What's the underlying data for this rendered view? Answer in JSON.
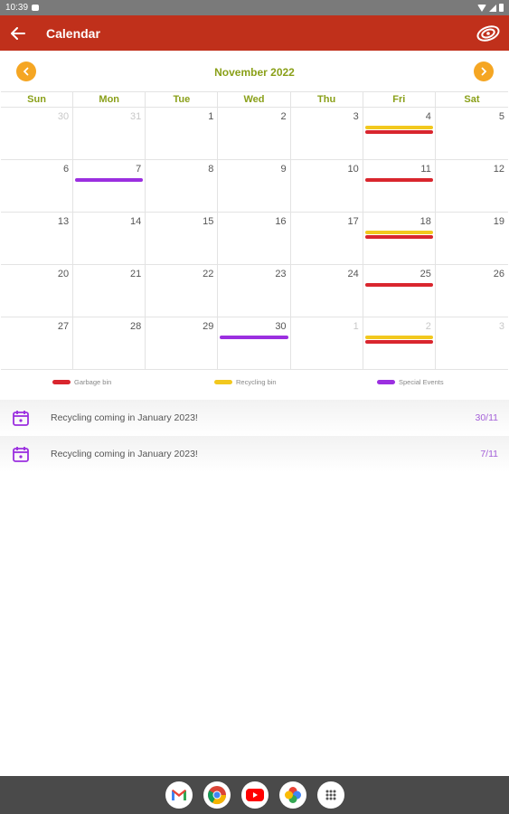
{
  "status_bar": {
    "time": "10:39"
  },
  "app_bar": {
    "title": "Calendar"
  },
  "calendar": {
    "month_title": "November 2022",
    "weekdays": [
      "Sun",
      "Mon",
      "Tue",
      "Wed",
      "Thu",
      "Fri",
      "Sat"
    ],
    "days": [
      {
        "d": "30",
        "other": true,
        "ev": []
      },
      {
        "d": "31",
        "other": true,
        "ev": []
      },
      {
        "d": "1",
        "ev": []
      },
      {
        "d": "2",
        "ev": []
      },
      {
        "d": "3",
        "ev": []
      },
      {
        "d": "4",
        "ev": [
          "recycling",
          "garbage"
        ]
      },
      {
        "d": "5",
        "ev": []
      },
      {
        "d": "6",
        "ev": []
      },
      {
        "d": "7",
        "ev": [
          "special"
        ]
      },
      {
        "d": "8",
        "ev": []
      },
      {
        "d": "9",
        "ev": []
      },
      {
        "d": "10",
        "ev": []
      },
      {
        "d": "11",
        "ev": [
          "garbage"
        ]
      },
      {
        "d": "12",
        "ev": []
      },
      {
        "d": "13",
        "ev": []
      },
      {
        "d": "14",
        "ev": []
      },
      {
        "d": "15",
        "ev": []
      },
      {
        "d": "16",
        "ev": []
      },
      {
        "d": "17",
        "ev": []
      },
      {
        "d": "18",
        "ev": [
          "recycling",
          "garbage"
        ]
      },
      {
        "d": "19",
        "ev": []
      },
      {
        "d": "20",
        "ev": []
      },
      {
        "d": "21",
        "ev": []
      },
      {
        "d": "22",
        "ev": []
      },
      {
        "d": "23",
        "ev": []
      },
      {
        "d": "24",
        "ev": []
      },
      {
        "d": "25",
        "ev": [
          "garbage"
        ]
      },
      {
        "d": "26",
        "ev": []
      },
      {
        "d": "27",
        "ev": []
      },
      {
        "d": "28",
        "ev": []
      },
      {
        "d": "29",
        "ev": []
      },
      {
        "d": "30",
        "ev": [
          "special"
        ]
      },
      {
        "d": "1",
        "other": true,
        "ev": []
      },
      {
        "d": "2",
        "other": true,
        "ev": [
          "recycling",
          "garbage"
        ]
      },
      {
        "d": "3",
        "other": true,
        "ev": []
      }
    ]
  },
  "colors": {
    "garbage": "#d9262e",
    "recycling": "#f2c81e",
    "special": "#9b2fe0",
    "accent": "#f5a623",
    "header": "#c0301b",
    "weekday_text": "#8aa019"
  },
  "legend": [
    {
      "key": "garbage",
      "label": "Garbage bin"
    },
    {
      "key": "recycling",
      "label": "Recycling bin"
    },
    {
      "key": "special",
      "label": "Special Events"
    }
  ],
  "events": [
    {
      "title": "Recycling coming in January 2023!",
      "date": "30/11",
      "icon": "calendar-event-icon"
    },
    {
      "title": "Recycling coming in January 2023!",
      "date": "7/11",
      "icon": "calendar-event-icon"
    }
  ],
  "dock": [
    "gmail-icon",
    "chrome-icon",
    "youtube-icon",
    "photos-icon",
    "app-drawer-icon"
  ]
}
